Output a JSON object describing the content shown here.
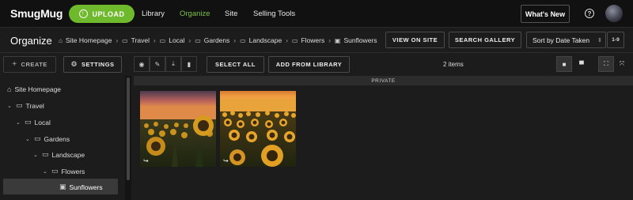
{
  "topbar": {
    "logo": "SmugMug",
    "upload_label": "UPLOAD",
    "nav": [
      "Library",
      "Organize",
      "Site",
      "Selling Tools"
    ],
    "whats_new": "What's New",
    "help_glyph": "?",
    "accent_color": "#6fba2c"
  },
  "header": {
    "title": "Organize",
    "breadcrumb": [
      "Site Homepage",
      "Travel",
      "Local",
      "Gardens",
      "Landscape",
      "Flowers",
      "Sunflowers"
    ],
    "view_on_site": "VIEW ON SITE",
    "search_gallery": "SEARCH GALLERY",
    "sort_value": "Sort by Date Taken",
    "range_label": "1-9"
  },
  "toolbar": {
    "create": "CREATE",
    "settings": "SETTINGS",
    "select_all": "SELECT ALL",
    "add_from_library": "ADD FROM LIBRARY",
    "items_count": "2 items",
    "icons": [
      "eye-icon",
      "wrench-icon",
      "download-icon",
      "trash-icon"
    ]
  },
  "sidebar": {
    "items": [
      {
        "label": "Site Homepage",
        "icon": "home-icon"
      },
      {
        "label": "Travel",
        "icon": "folder-icon",
        "expanded": true
      },
      {
        "label": "Local",
        "icon": "folder-icon",
        "expanded": true
      },
      {
        "label": "Gardens",
        "icon": "folder-icon",
        "expanded": true
      },
      {
        "label": "Landscape",
        "icon": "folder-icon",
        "expanded": true
      },
      {
        "label": "Flowers",
        "icon": "folder-icon",
        "expanded": true
      },
      {
        "label": "Sunflowers",
        "icon": "gallery-icon",
        "selected": true
      }
    ]
  },
  "content": {
    "privacy_label": "PRIVATE",
    "photos": [
      {
        "name": "sunflower-photo-1"
      },
      {
        "name": "sunflower-photo-2"
      }
    ]
  }
}
